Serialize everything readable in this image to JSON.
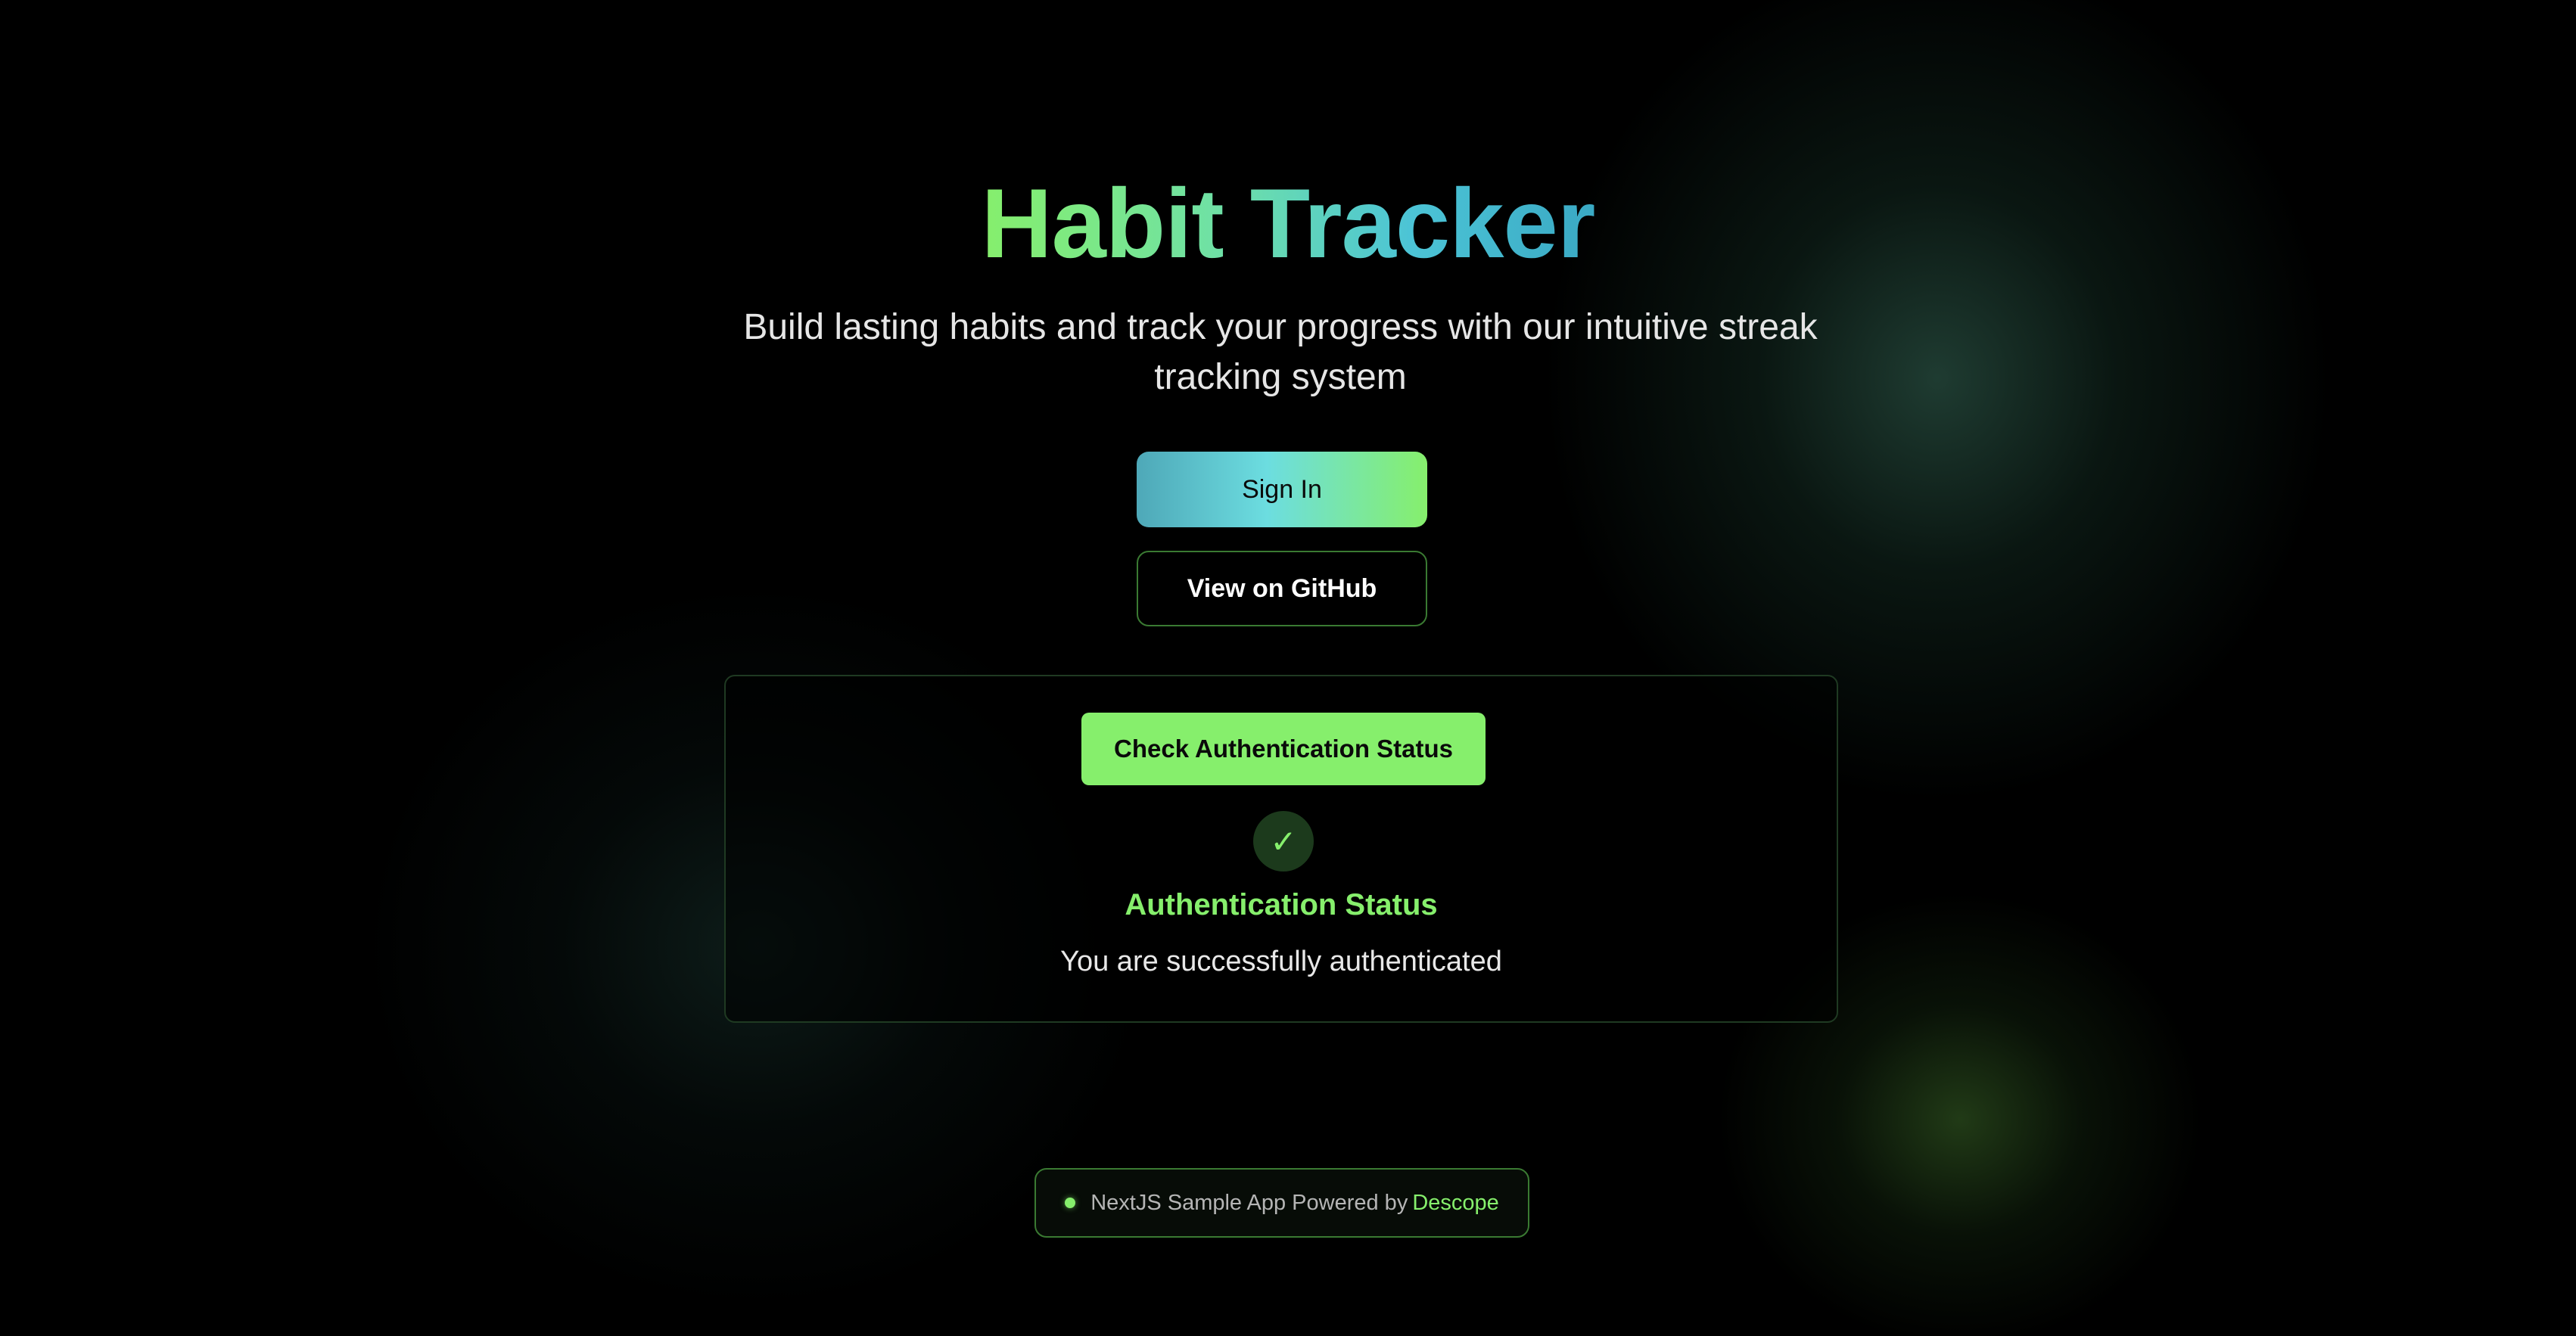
{
  "hero": {
    "title": "Habit Tracker",
    "subtitle": "Build lasting habits and track your progress with our intuitive streak tracking system"
  },
  "actions": {
    "sign_in_label": "Sign In",
    "github_label": "View on GitHub"
  },
  "auth_card": {
    "check_button_label": "Check Authentication Status",
    "status_icon": "check-icon",
    "status_glyph": "✓",
    "status_title": "Authentication Status",
    "status_message": "You are successfully authenticated"
  },
  "footer": {
    "text": "NextJS Sample App Powered by",
    "link_label": "Descope"
  },
  "colors": {
    "accent_green": "#86ef6c",
    "accent_teal": "#4cc4d6",
    "background": "#000000"
  }
}
